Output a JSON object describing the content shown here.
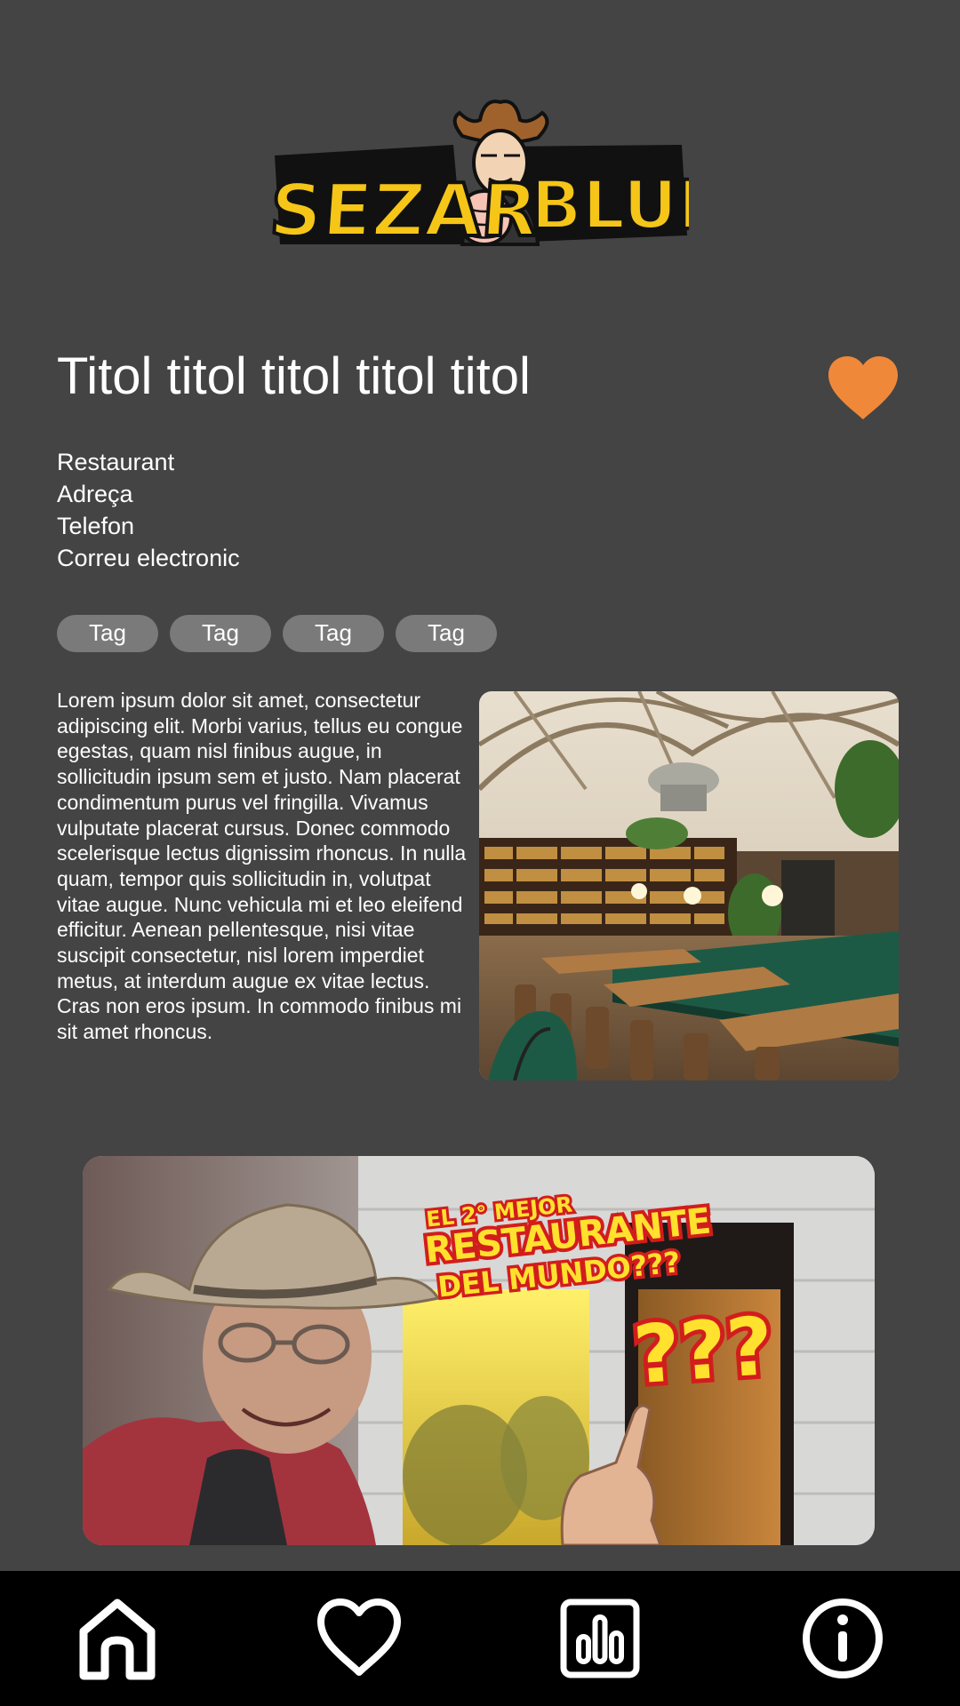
{
  "logo": {
    "text_left": "SEZAR",
    "text_right": "BLUE",
    "colors": {
      "fill": "#f5c518",
      "outline": "#111111"
    }
  },
  "restaurant": {
    "title": "Titol titol titol titol titol",
    "name": "Restaurant",
    "address": "Adreça",
    "phone": "Telefon",
    "email": "Correu electronic",
    "favorite": true,
    "favorite_color": "#f0883a"
  },
  "tags": [
    "Tag",
    "Tag",
    "Tag",
    "Tag"
  ],
  "description": "Lorem ipsum dolor sit amet, consectetur adipiscing elit. Morbi varius, tellus eu congue egestas, quam nisl finibus augue, in sollicitudin ipsum sem et justo. Nam placerat condimentum purus vel fringilla. Vivamus vulputate placerat cursus. Donec commodo scelerisque lectus dignissim rhoncus. In nulla quam, tempor quis sollicitudin in, volutpat vitae augue. Nunc vehicula mi et leo eleifend efficitur. Aenean pellentesque, nisi vitae suscipit consectetur, nisl lorem imperdiet metus, at interdum augue ex vitae lectus. Cras non eros ipsum. In commodo finibus mi sit amet rhoncus.",
  "video": {
    "caption_line1": "EL 2° MEJOR",
    "caption_line2": "RESTAURANTE",
    "caption_line3": "DEL MUNDO???",
    "caption_badge": "???"
  },
  "nav": {
    "items": [
      {
        "icon": "home-icon"
      },
      {
        "icon": "heart-icon"
      },
      {
        "icon": "chart-icon"
      },
      {
        "icon": "info-icon"
      }
    ]
  },
  "theme": {
    "background": "#444444",
    "navbar": "#000000",
    "tag_bg": "#7a7a7a",
    "accent": "#f0883a"
  }
}
